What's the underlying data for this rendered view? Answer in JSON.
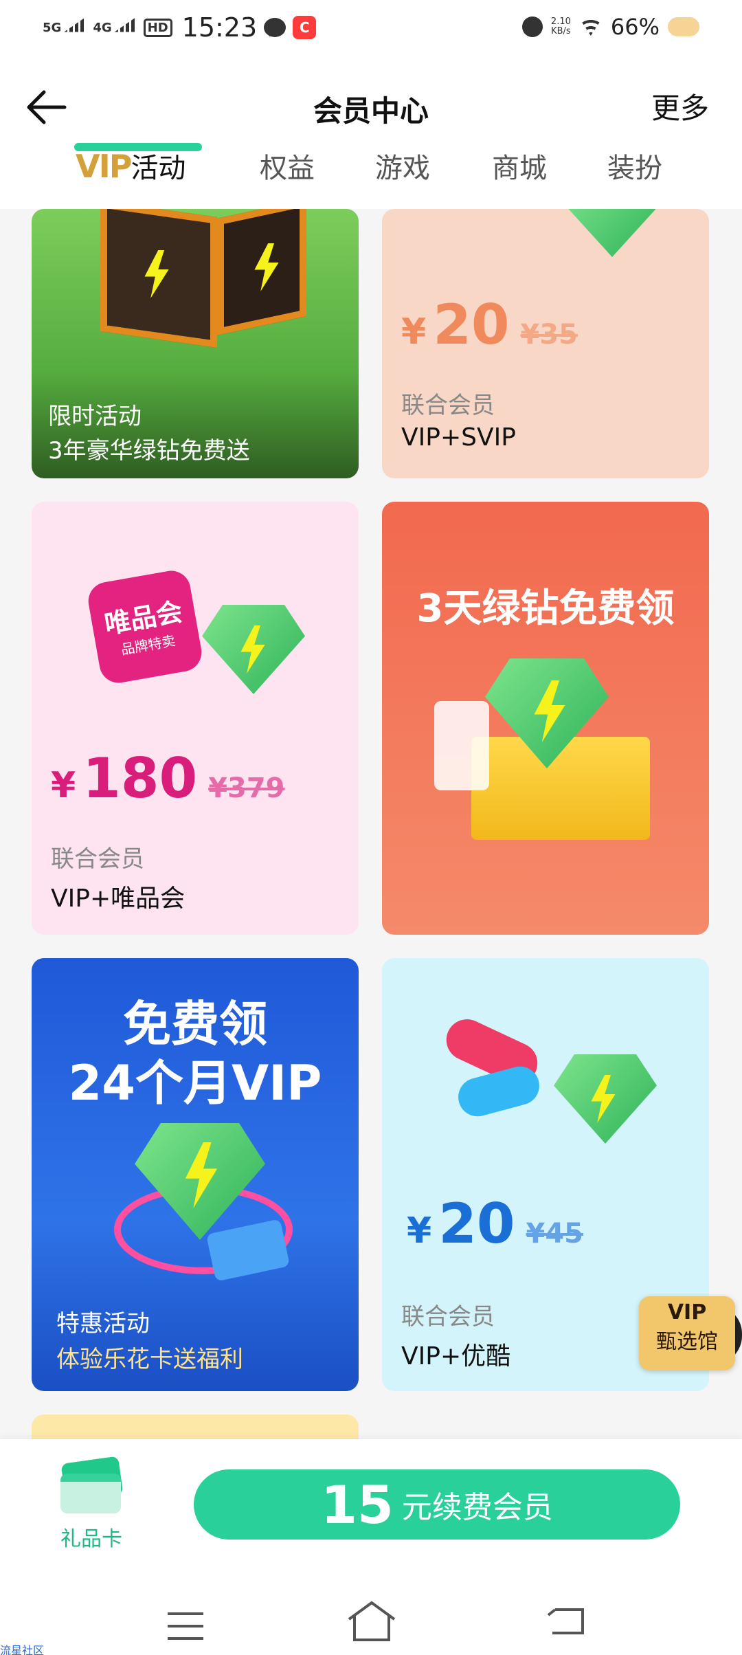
{
  "status_bar": {
    "network1": "5G",
    "network2": "4G",
    "hd": "HD",
    "time": "15:23",
    "app_icon": "C",
    "netspeed_value": "2.10",
    "netspeed_unit": "KB/s",
    "battery": "66%"
  },
  "header": {
    "title": "会员中心",
    "more": "更多"
  },
  "tabs": [
    {
      "vip_mark": "VIP",
      "label": "活动",
      "active": true
    },
    {
      "label": "权益"
    },
    {
      "label": "游戏"
    },
    {
      "label": "商城"
    },
    {
      "label": "装扮"
    }
  ],
  "cards": {
    "card1": {
      "tag": "限时活动",
      "title": "3年豪华绿钻免费送"
    },
    "card2": {
      "yen": "¥",
      "price": "20",
      "old_price": "¥35",
      "sub": "联合会员",
      "title": "VIP+SVIP"
    },
    "card3": {
      "logo": "唯品会",
      "logo_sub": "品牌特卖",
      "yen": "¥",
      "price": "180",
      "old_price": "¥379",
      "sub": "联合会员",
      "title": "VIP+唯品会"
    },
    "card4": {
      "headline": "3天绿钻免费领"
    },
    "card5": {
      "headline1": "免费领",
      "headline2": "24个月VIP",
      "tag": "特惠活动",
      "title": "体验乐花卡送福利"
    },
    "card6": {
      "yen": "¥",
      "price": "20",
      "old_price": "¥45",
      "sub": "联合会员",
      "title": "VIP+优酷"
    }
  },
  "vip_store": {
    "line1": "VIP",
    "line2": "甄选馆"
  },
  "bottom": {
    "gift_label": "礼品卡",
    "renew_amount": "15",
    "renew_text": "元续费会员"
  },
  "watermark": "流星社区",
  "colors": {
    "accent": "#2ad09a",
    "pink_price": "#d81e7a",
    "orange_price": "#f08a5d",
    "blue_price": "#1a6fd6"
  }
}
